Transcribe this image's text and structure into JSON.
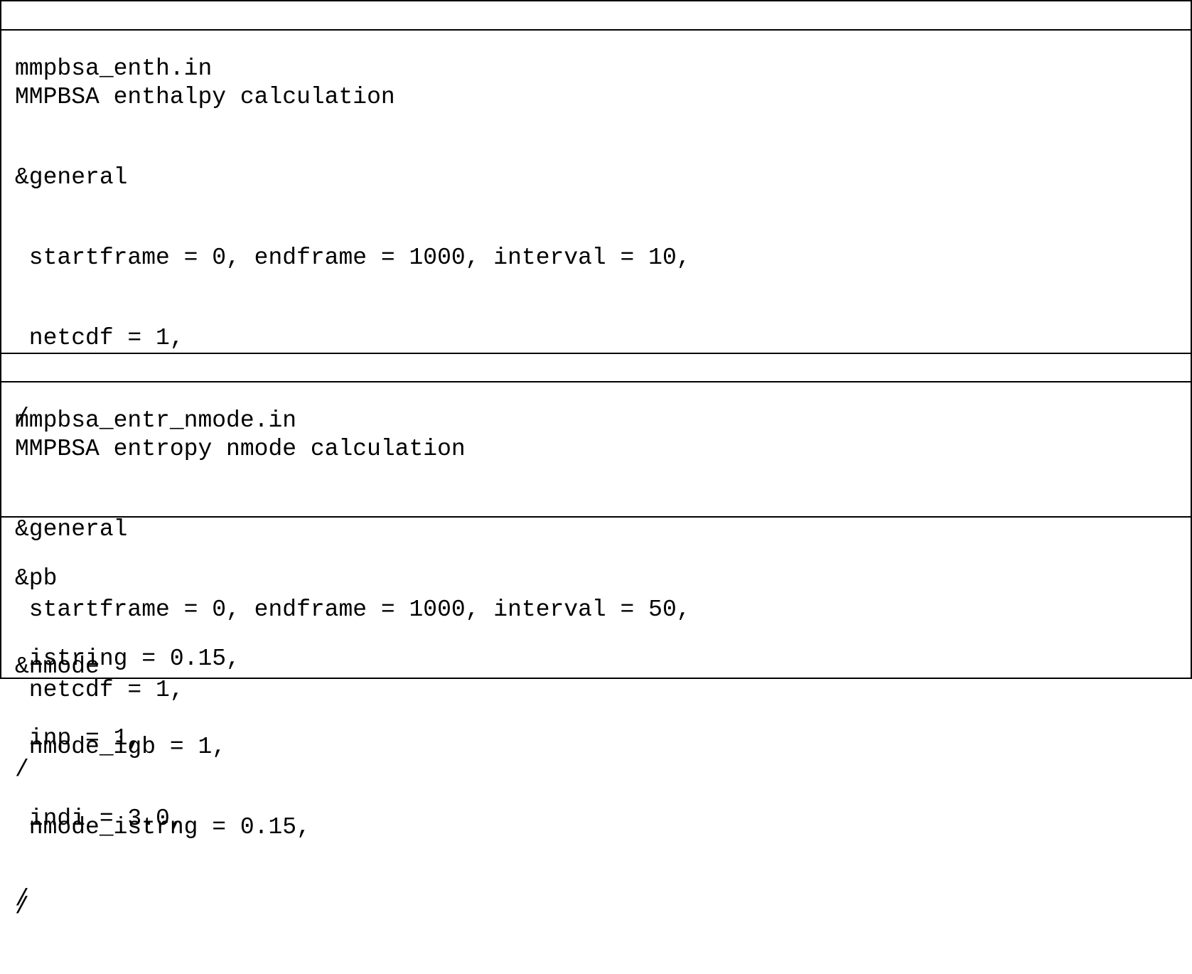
{
  "sections": [
    {
      "filename": "mmpbsa_enth.in",
      "lines": [
        "MMPBSA enthalpy calculation",
        "&general",
        " startframe = 0, endframe = 1000, interval = 10,",
        " netcdf = 1,",
        "/",
        "",
        "&pb",
        " istring = 0.15,",
        " inp = 1,",
        " indi = 3.0,",
        "/"
      ]
    },
    {
      "filename": "mmpbsa_entr_nmode.in",
      "lines_general": [
        "MMPBSA entropy nmode calculation",
        "&general",
        " startframe = 0, endframe = 1000, interval = 50,",
        " netcdf = 1,",
        "/"
      ],
      "lines_nmode": [
        "",
        "&nmode",
        " nmode_igb = 1,",
        " nmode_istrng = 0.15,",
        "/"
      ]
    }
  ]
}
